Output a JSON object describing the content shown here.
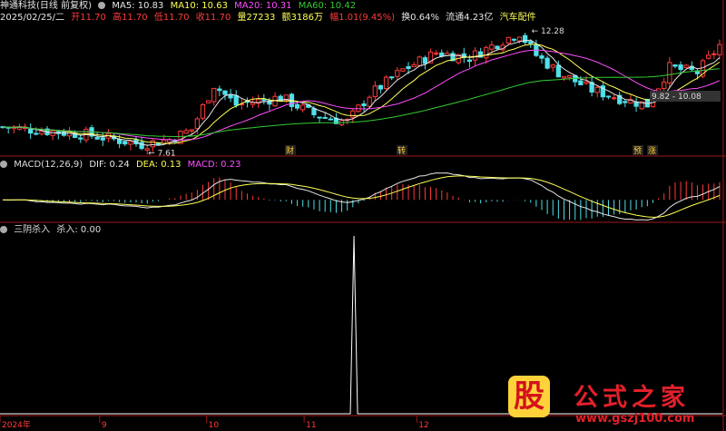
{
  "header1": {
    "title": "神通科技(日线 前复权)",
    "ma": [
      {
        "label": "MA5: 10.83",
        "color": "#e6e6e6"
      },
      {
        "label": "MA10: 10.63",
        "color": "#ffff55"
      },
      {
        "label": "MA20: 10.31",
        "color": "#ff4dff"
      },
      {
        "label": "MA60: 10.42",
        "color": "#33cc33"
      }
    ]
  },
  "header2": {
    "date": "2025/02/25/二",
    "open": "开11.70",
    "high": "高11.70",
    "low": "低11.70",
    "close": "收11.70",
    "volume": "量27233",
    "amount": "额3186万",
    "change": "幅1.01(9.45%)",
    "turnover": "换0.64%",
    "float": "流通4.23亿",
    "sector": "汽车配件"
  },
  "macd_header": {
    "title": "MACD(12,26,9)",
    "dif": "DIF: 0.24",
    "dea": "DEA: 0.13",
    "macd": "MACD: 0.23"
  },
  "indicator_header": {
    "title": "三阴杀入",
    "value": "杀入: 0.00"
  },
  "logo": {
    "glyph": "股",
    "name": "公式之家",
    "url": "www.gszj100.com"
  },
  "chart_data": [
    {
      "type": "candlestick",
      "ylim": [
        7.3,
        12.5
      ],
      "annotations": [
        {
          "text": "12.28",
          "value": 12.28
        },
        {
          "text": "7.61",
          "value": 7.61
        },
        {
          "text": "9.82 - 10.08"
        }
      ],
      "event_markers": [
        "财",
        "转",
        "预",
        "涨"
      ],
      "series_colors": {
        "up": "#ff3b3b",
        "down": "#4fe0e8",
        "ma5": "#e6e6e6",
        "ma10": "#ffff55",
        "ma20": "#ff4dff",
        "ma60": "#33cc33"
      }
    },
    {
      "type": "bar",
      "name": "MACD",
      "ylim": [
        -0.45,
        0.6
      ],
      "lines": [
        {
          "name": "DIF",
          "color": "#e6e6e6"
        },
        {
          "name": "DEA",
          "color": "#ffff55"
        }
      ]
    },
    {
      "type": "line",
      "name": "三阴杀入",
      "ylim": [
        0,
        1
      ],
      "spike": {
        "value": 1,
        "position_fraction": 0.49
      }
    }
  ],
  "x_axis": {
    "ticks": [
      {
        "label": "2024年",
        "pos": 0.0
      },
      {
        "label": "9",
        "pos": 0.138
      },
      {
        "label": "10",
        "pos": 0.286
      },
      {
        "label": "11",
        "pos": 0.421
      },
      {
        "label": "12",
        "pos": 0.577
      }
    ]
  }
}
